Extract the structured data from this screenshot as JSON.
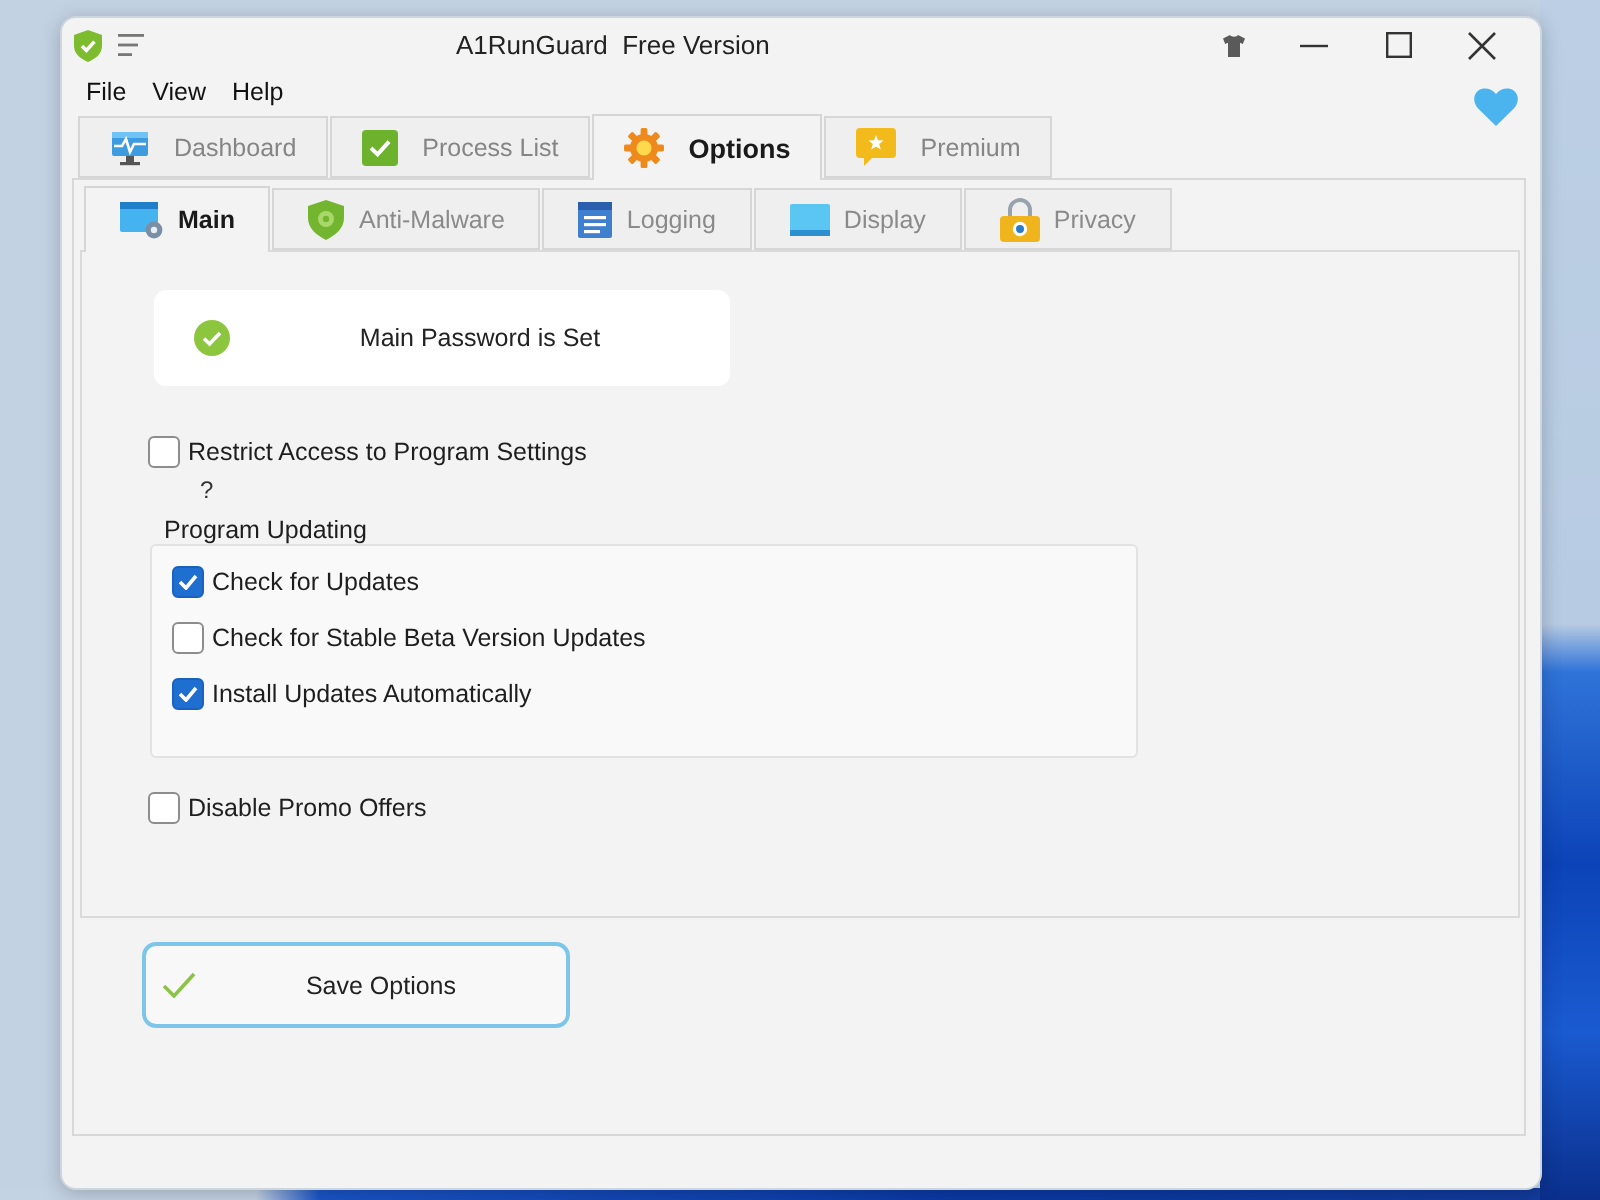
{
  "window": {
    "title": "A1RunGuard  Free Version"
  },
  "menu": [
    {
      "label": "File"
    },
    {
      "label": "View"
    },
    {
      "label": "Help"
    }
  ],
  "tabs": [
    {
      "label": "Dashboard",
      "selected": false
    },
    {
      "label": "Process List",
      "selected": false
    },
    {
      "label": "Options",
      "selected": true
    },
    {
      "label": "Premium",
      "selected": false
    }
  ],
  "subtabs": [
    {
      "label": "Main",
      "selected": true
    },
    {
      "label": "Anti-Malware",
      "selected": false
    },
    {
      "label": "Logging",
      "selected": false
    },
    {
      "label": "Display",
      "selected": false
    },
    {
      "label": "Privacy",
      "selected": false
    }
  ],
  "main": {
    "password_status": "Main Password is Set",
    "restrict_access": {
      "label": "Restrict Access to Program Settings",
      "checked": false
    },
    "help": "?",
    "program_updating": {
      "title": "Program Updating",
      "options": [
        {
          "label": "Check for Updates",
          "checked": true
        },
        {
          "label": "Check for Stable Beta Version Updates",
          "checked": false
        },
        {
          "label": "Install Updates Automatically",
          "checked": true
        }
      ]
    },
    "promo_offers": {
      "label": "Disable Promo Offers",
      "checked": false
    }
  },
  "save_button": {
    "label": "Save Options"
  }
}
